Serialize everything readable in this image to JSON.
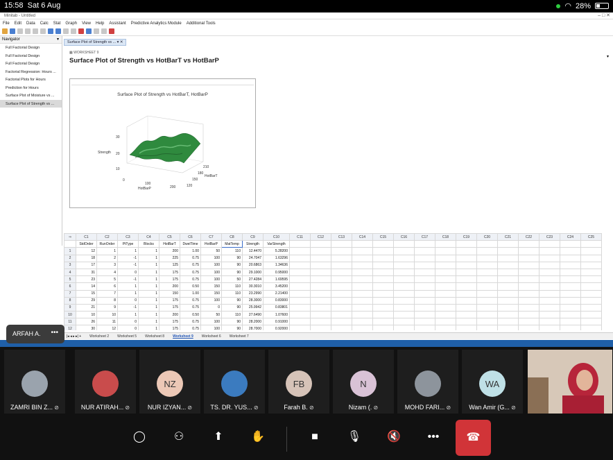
{
  "status_bar": {
    "time": "15:58",
    "date": "Sat 6 Aug",
    "battery": "28%"
  },
  "minitab": {
    "title": "Minitab - Untitled",
    "menus": [
      "File",
      "Edit",
      "Data",
      "Calc",
      "Stat",
      "Graph",
      "View",
      "Help",
      "Assistant",
      "Predictive Analytics Module",
      "Additional Tools"
    ],
    "navigator": {
      "title": "Navigator",
      "items": [
        "Full Factorial Design",
        "Full Factorial Design",
        "Full Factorial Design",
        "Factorial Regression: Hours ...",
        "Factorial Plots for Hours",
        "Prediction for Hours",
        "Surface Plot of Moisture vs ...",
        "Surface Plot of Strength vs ..."
      ]
    },
    "doc_tab": "Surface Plot of Strength vs ...",
    "worksheet_label": "WORKSHEET 9",
    "output_title": "Surface Plot of Strength vs HotBarT vs HotBarP",
    "graph": {
      "title": "Surface Plot of Strength vs HotBarT, HotBarP",
      "z_label": "Strength",
      "z_ticks": [
        "30",
        "20",
        "10"
      ],
      "x_label": "HotBarP",
      "x_ticks": [
        "0",
        "100",
        "200"
      ],
      "y_label": "HotBarT",
      "y_ticks": [
        "120",
        "150",
        "180",
        "210"
      ]
    },
    "grid": {
      "col_ids": [
        "C1",
        "C2",
        "C3",
        "C4",
        "C5",
        "C6",
        "C7",
        "C8",
        "C9",
        "C10",
        "C11",
        "C12",
        "C13",
        "C14",
        "C15",
        "C16",
        "C17",
        "C18",
        "C19",
        "C20",
        "C21",
        "C22",
        "C23",
        "C24",
        "C25"
      ],
      "col_names": [
        "StdOrder",
        "RunOrder",
        "PtType",
        "Blocks",
        "HotBarT",
        "DwelTime",
        "HotBarP",
        "MatTemp",
        "Strength",
        "VarStrength",
        "",
        "",
        "",
        "",
        "",
        "",
        "",
        "",
        "",
        "",
        "",
        "",
        "",
        "",
        ""
      ],
      "rows": [
        [
          "1",
          "12",
          "1",
          "1",
          "1",
          "200",
          "1.00",
          "50",
          "110",
          "12.4470",
          "5.28200"
        ],
        [
          "2",
          "18",
          "2",
          "-1",
          "1",
          "225",
          "0.75",
          "100",
          "90",
          "24.7047",
          "1.63296"
        ],
        [
          "3",
          "17",
          "3",
          "-1",
          "1",
          "125",
          "0.75",
          "100",
          "90",
          "20.6863",
          "1.34636"
        ],
        [
          "4",
          "31",
          "4",
          "0",
          "1",
          "175",
          "0.75",
          "100",
          "90",
          "29.1000",
          "0.95000"
        ],
        [
          "5",
          "23",
          "5",
          "-1",
          "1",
          "175",
          "0.75",
          "100",
          "50",
          "27.4284",
          "1.69595"
        ],
        [
          "6",
          "14",
          "6",
          "1",
          "1",
          "200",
          "0.50",
          "150",
          "110",
          "30.3010",
          "3.45200"
        ],
        [
          "7",
          "15",
          "7",
          "1",
          "1",
          "150",
          "1.00",
          "150",
          "110",
          "23.2990",
          "2.21400"
        ],
        [
          "8",
          "29",
          "8",
          "0",
          "1",
          "175",
          "0.75",
          "100",
          "90",
          "28.3000",
          "0.83000"
        ],
        [
          "9",
          "21",
          "9",
          "-1",
          "1",
          "175",
          "0.75",
          "0",
          "90",
          "25.9942",
          "0.83801"
        ],
        [
          "10",
          "10",
          "10",
          "1",
          "1",
          "200",
          "0.50",
          "50",
          "110",
          "27.6490",
          "1.07600"
        ],
        [
          "11",
          "26",
          "11",
          "0",
          "1",
          "175",
          "0.75",
          "100",
          "90",
          "28.2000",
          "0.91000"
        ],
        [
          "12",
          "30",
          "12",
          "0",
          "1",
          "175",
          "0.75",
          "100",
          "90",
          "28.7000",
          "0.92000"
        ]
      ]
    },
    "sheet_tabs": [
      "Worksheet 2",
      "Worksheet 5",
      "Worksheet 8",
      "Worksheet 9",
      "Worksheet 6",
      "Worksheet 7"
    ],
    "active_sheet": "Worksheet 9"
  },
  "presenter_bubble": {
    "name": "ARFAH A.",
    "more": "•••"
  },
  "participants": [
    {
      "name": "ZAMRI BIN Z...",
      "initials": "",
      "avatar_color": "#9aa3ad"
    },
    {
      "name": "NUR ATIRAH...",
      "initials": "",
      "avatar_color": "#c94c4c"
    },
    {
      "name": "NUR IZYAN...",
      "initials": "NZ",
      "avatar_color": "#ecc8b6"
    },
    {
      "name": "TS. DR. YUS...",
      "initials": "",
      "avatar_color": "#3b7bbf"
    },
    {
      "name": "Farah B.",
      "initials": "FB",
      "avatar_color": "#d6c3b8"
    },
    {
      "name": "Nizam (.",
      "initials": "N",
      "avatar_color": "#d9c2d6"
    },
    {
      "name": "MOHD FARI...",
      "initials": "",
      "avatar_color": "#8d949c"
    },
    {
      "name": "Wan Amir (G...",
      "initials": "WA",
      "avatar_color": "#bfe0e6"
    }
  ]
}
